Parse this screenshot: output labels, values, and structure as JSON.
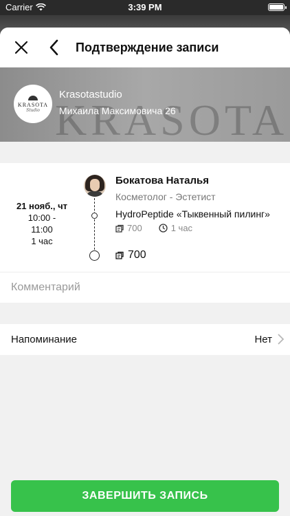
{
  "status_bar": {
    "carrier": "Carrier",
    "time": "3:39 PM"
  },
  "nav": {
    "title": "Подтверждение записи"
  },
  "studio": {
    "logo_text": "KRASOTA",
    "logo_script": "Studio",
    "name": "Krasotastudio",
    "address": "Михаила Максимовича 26",
    "banner_word": "KRASOTA"
  },
  "booking": {
    "date": "21 нояб., чт",
    "time_range": "10:00 -\n11:00",
    "time_start": "10:00 -",
    "time_end": "11:00",
    "duration": "1 час",
    "master_name": "Бокатова Наталья",
    "master_role": "Косметолог - Эстетист",
    "service": "HydroPeptide «Тыквенный пилинг»",
    "service_price": "700",
    "service_duration": "1 час",
    "total": "700"
  },
  "comment": {
    "placeholder": "Комментарий"
  },
  "reminder": {
    "label": "Напоминание",
    "value": "Нет"
  },
  "submit": {
    "label": "ЗАВЕРШИТЬ ЗАПИСЬ"
  },
  "colors": {
    "accent": "#37c24b",
    "background": "#f1f1f1"
  }
}
